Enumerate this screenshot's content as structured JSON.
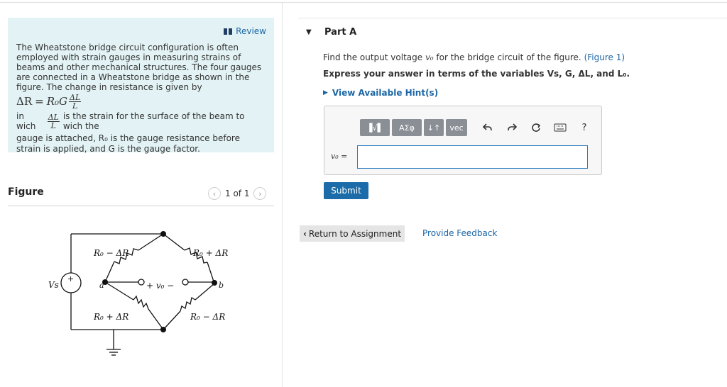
{
  "intro": {
    "review_label": "Review",
    "paragraph": "The Wheatstone bridge circuit configuration is often employed with strain gauges in measuring strains of beams and other mechanical structures. The four gauges are connected in a Wheatstone bridge as shown in the figure. The change in resistance is given by",
    "equation_lhs": "ΔR",
    "equation_eq": "=",
    "equation_rhs": "R₀G",
    "frac_num": "ΔL",
    "frac_den": "L",
    "strain_prefix": "in wich",
    "strain_suffix": "is the strain for the surface of the beam to wich the",
    "tail": "gauge is attached, R₀ is the gauge resistance before strain is applied, and G is the gauge factor."
  },
  "figure": {
    "label": "Figure",
    "pager": "1 of 1",
    "prev_icon": "‹",
    "next_icon": "›",
    "circuit": {
      "r_top_left": "R₀ − ΔR",
      "r_top_right": "R₀ + ΔR",
      "r_bot_left": "R₀ + ΔR",
      "r_bot_right": "R₀ − ΔR",
      "source": "Vs",
      "node_a": "a",
      "node_b": "b",
      "output": "+  v₀  −",
      "plus": "+"
    }
  },
  "part": {
    "title": "Part A",
    "question_prefix": "Find the output voltage",
    "question_var": "v₀",
    "question_suffix": "for the bridge circuit of the figure.",
    "figure_link": "(Figure 1)",
    "express": "Express your answer in terms of the variables Vs, G, ΔL, and L₀.",
    "hint": "View Available Hint(s)"
  },
  "answer": {
    "label": "v₀ =",
    "value": "",
    "toolbar": [
      "▐√▌",
      "ΑΣφ",
      "↓↑",
      "vec"
    ],
    "icons": [
      "undo-icon",
      "redo-icon",
      "reset-icon",
      "keyboard-icon",
      "help-icon"
    ],
    "help": "?"
  },
  "actions": {
    "submit": "Submit",
    "return": "Return to Assignment",
    "feedback": "Provide Feedback"
  }
}
